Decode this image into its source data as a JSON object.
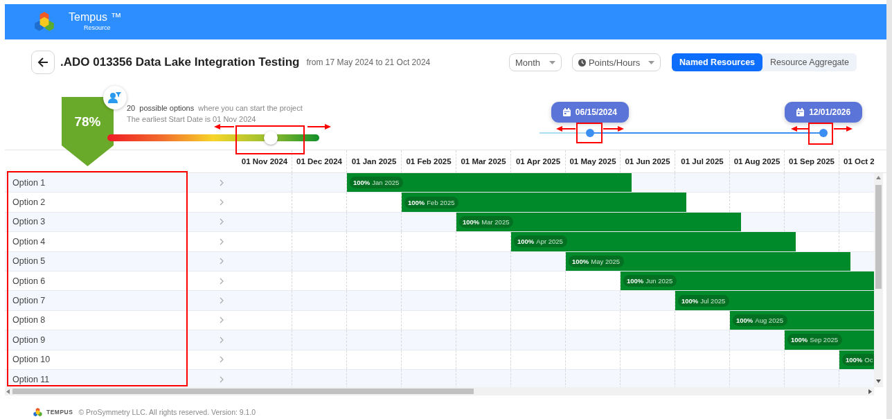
{
  "header": {
    "app_name": "Tempus ™",
    "subtitle": "Resource"
  },
  "project": {
    "title": ".ADO 013356 Data Lake Integration Testing",
    "date_range": "from 17 May 2024 to 21 Oct 2024"
  },
  "controls": {
    "period": {
      "value": "Month"
    },
    "unit": {
      "value": "Points/Hours"
    },
    "modes": [
      {
        "label": "Named Resources",
        "selected": true
      },
      {
        "label": "Resource Aggregate",
        "selected": false
      }
    ]
  },
  "score": {
    "percent": "78%",
    "summary": "**20  possible options**  where you can start the project",
    "earliest": "The earliest Start Date is 01 Nov 2024",
    "level": 0.77
  },
  "date_range_picker": {
    "start": {
      "date": "06/15/2024",
      "level": 0.157
    },
    "end": {
      "date": "12/01/2026",
      "level": 0.884
    }
  },
  "gantt": {
    "columns": [
      "01 Nov 2024",
      "01 Dec 2024",
      "01 Jan 2025",
      "01 Feb 2025",
      "01 Mar 2025",
      "01 Apr 2025",
      "01 May 2025",
      "01 Jun 2025",
      "01 Jul 2025",
      "01 Aug 2025",
      "01 Sep 2025",
      "01 Oct 2"
    ],
    "rows": [
      {
        "name": "Option 1",
        "bar": {
          "percent": "100%",
          "label": "Jan 2025"
        }
      },
      {
        "name": "Option 2",
        "bar": {
          "percent": "100%",
          "label": "Feb 2025"
        }
      },
      {
        "name": "Option 3",
        "bar": {
          "percent": "100%",
          "label": "Mar 2025"
        }
      },
      {
        "name": "Option 4",
        "bar": {
          "percent": "100%",
          "label": "Apr 2025"
        }
      },
      {
        "name": "Option 5",
        "bar": {
          "percent": "100%",
          "label": "May 2025"
        }
      },
      {
        "name": "Option 6",
        "bar": {
          "percent": "100%",
          "label": "Jun 2025"
        }
      },
      {
        "name": "Option 7",
        "bar": {
          "percent": "100%",
          "label": "Jul 2025"
        }
      },
      {
        "name": "Option 8",
        "bar": {
          "percent": "100%",
          "label": "Aug 2025"
        }
      },
      {
        "name": "Option 9",
        "bar": {
          "percent": "100%",
          "label": "Sep 2025"
        }
      },
      {
        "name": "Option 10",
        "bar": {
          "percent": "100%",
          "label": "Oc"
        }
      },
      {
        "name": "Option 11"
      }
    ]
  },
  "footer": {
    "brand": "TEMPUS",
    "copyright": "© ProSymmetry LLC. All rights reserved. Version: 9.1.0"
  }
}
